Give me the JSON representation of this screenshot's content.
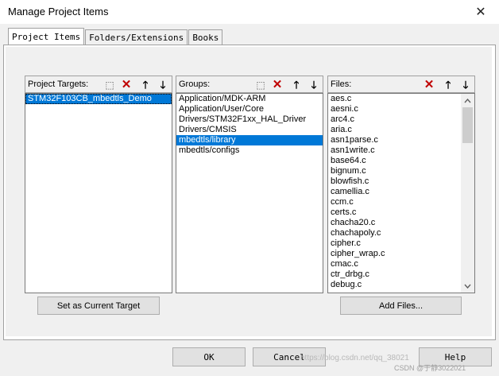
{
  "window": {
    "title": "Manage Project Items",
    "close_glyph": "✕"
  },
  "tabs": [
    {
      "label": "Project Items",
      "active": true
    },
    {
      "label": "Folders/Extensions",
      "active": false
    },
    {
      "label": "Books",
      "active": false
    }
  ],
  "targets": {
    "label": "Project Targets:",
    "items": [
      "STM32F103CB_mbedtls_Demo"
    ],
    "selected_index": 0
  },
  "groups": {
    "label": "Groups:",
    "items": [
      "Application/MDK-ARM",
      "Application/User/Core",
      "Drivers/STM32F1xx_HAL_Driver",
      "Drivers/CMSIS",
      "mbedtls/library",
      "mbedtls/configs"
    ],
    "selected_index": 4
  },
  "files": {
    "label": "Files:",
    "items": [
      "aes.c",
      "aesni.c",
      "arc4.c",
      "aria.c",
      "asn1parse.c",
      "asn1write.c",
      "base64.c",
      "bignum.c",
      "blowfish.c",
      "camellia.c",
      "ccm.c",
      "certs.c",
      "chacha20.c",
      "chachapoly.c",
      "cipher.c",
      "cipher_wrap.c",
      "cmac.c",
      "ctr_drbg.c",
      "debug.c"
    ]
  },
  "toolbar_icons": {
    "new": "⬚",
    "delete": "✕",
    "up": "🡑",
    "down": "🡓"
  },
  "buttons": {
    "set_target": "Set as Current Target",
    "add_files": "Add Files...",
    "ok": "OK",
    "cancel": "Cancel",
    "help": "Help"
  },
  "watermark": "https://blog.csdn.net/qq_38021",
  "csdn_tag": "CSDN @于静3022021"
}
